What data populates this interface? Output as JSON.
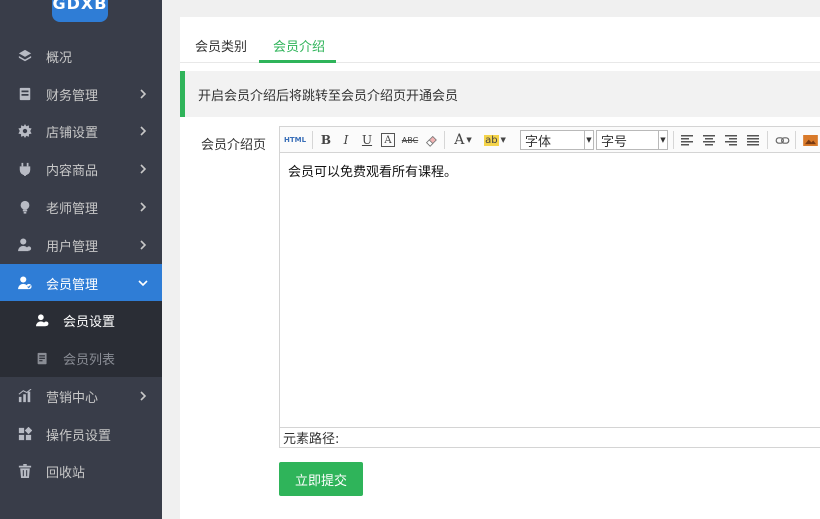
{
  "logo": {
    "text": "GDXB"
  },
  "sidebar": {
    "items": [
      {
        "label": "概况",
        "icon": "layers-icon",
        "has_arrow": false
      },
      {
        "label": "财务管理",
        "icon": "finance-icon",
        "has_arrow": true
      },
      {
        "label": "店铺设置",
        "icon": "gear-icon",
        "has_arrow": true
      },
      {
        "label": "内容商品",
        "icon": "plug-icon",
        "has_arrow": true
      },
      {
        "label": "老师管理",
        "icon": "lightbulb-icon",
        "has_arrow": true
      },
      {
        "label": "用户管理",
        "icon": "user-settings-icon",
        "has_arrow": true
      },
      {
        "label": "会员管理",
        "icon": "member-icon",
        "has_arrow": true,
        "active": true
      },
      {
        "label": "营销中心",
        "icon": "chart-icon",
        "has_arrow": true
      },
      {
        "label": "操作员设置",
        "icon": "grid-icon",
        "has_arrow": false
      },
      {
        "label": "回收站",
        "icon": "trash-icon",
        "has_arrow": false
      }
    ],
    "sub_items": [
      {
        "label": "会员设置",
        "icon": "member-settings-icon",
        "active": true
      },
      {
        "label": "会员列表",
        "icon": "document-icon",
        "active": false
      }
    ]
  },
  "tabs": [
    {
      "label": "会员类别",
      "active": false
    },
    {
      "label": "会员介绍",
      "active": true
    }
  ],
  "notice": {
    "text": "开启会员介绍后将跳转至会员介绍页开通会员"
  },
  "form": {
    "field_label": "会员介绍页",
    "editor": {
      "toolbar": {
        "html_label": "HTML",
        "bold": "B",
        "italic": "I",
        "underline": "U",
        "fontborder": "A",
        "strike": "ABC",
        "forecolor": "A",
        "backcolor": "ab",
        "font_family": "字体",
        "font_size": "字号"
      },
      "content": "会员可以免费观看所有课程。",
      "path_label": "元素路径:"
    },
    "submit_label": "立即提交"
  },
  "colors": {
    "sidebar_bg": "#393d49",
    "sidebar_active": "#2f7dd6",
    "accent_green": "#2fb45a"
  }
}
